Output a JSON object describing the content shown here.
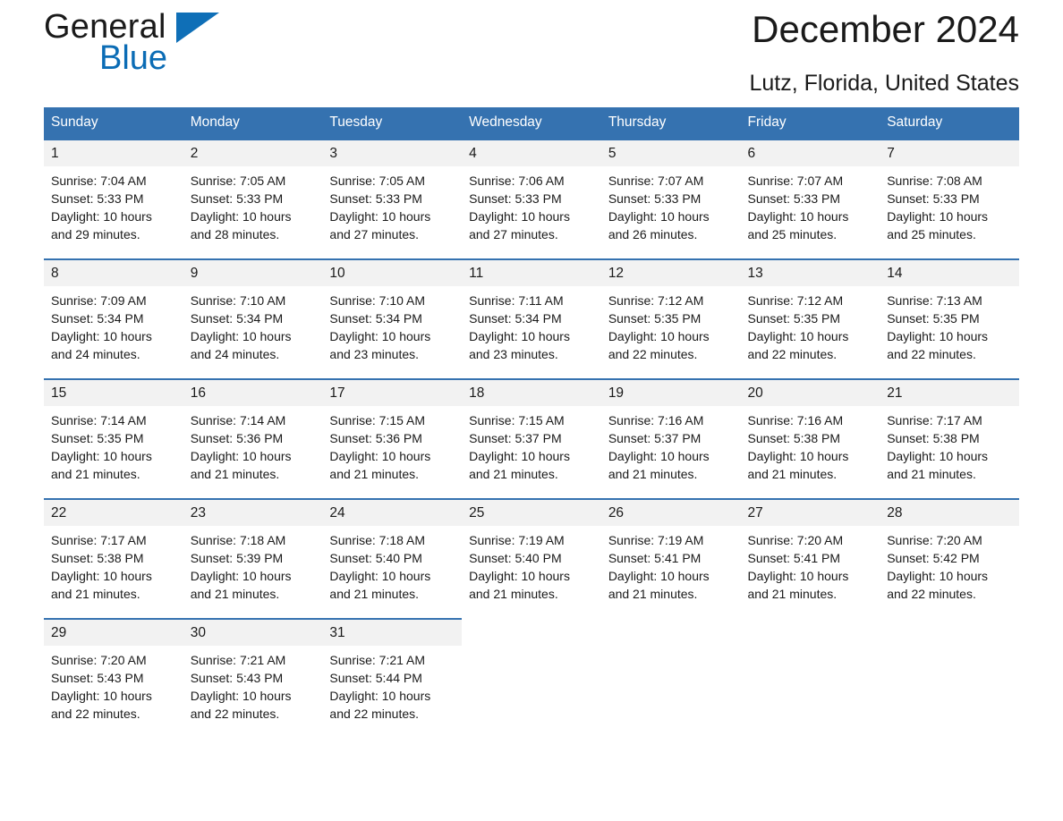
{
  "brand": {
    "name_part1": "General",
    "name_part2": "Blue",
    "flag_icon": "triangle-flag-icon",
    "accent_color": "#0f6fb7"
  },
  "header": {
    "title": "December 2024",
    "subtitle": "Lutz, Florida, United States"
  },
  "calendar": {
    "header_bg": "#3572b0",
    "daynum_bg": "#f2f2f2",
    "weekdays": [
      "Sunday",
      "Monday",
      "Tuesday",
      "Wednesday",
      "Thursday",
      "Friday",
      "Saturday"
    ],
    "weeks": [
      [
        {
          "day": "1",
          "sunrise": "Sunrise: 7:04 AM",
          "sunset": "Sunset: 5:33 PM",
          "daylight_line1": "Daylight: 10 hours",
          "daylight_line2": "and 29 minutes."
        },
        {
          "day": "2",
          "sunrise": "Sunrise: 7:05 AM",
          "sunset": "Sunset: 5:33 PM",
          "daylight_line1": "Daylight: 10 hours",
          "daylight_line2": "and 28 minutes."
        },
        {
          "day": "3",
          "sunrise": "Sunrise: 7:05 AM",
          "sunset": "Sunset: 5:33 PM",
          "daylight_line1": "Daylight: 10 hours",
          "daylight_line2": "and 27 minutes."
        },
        {
          "day": "4",
          "sunrise": "Sunrise: 7:06 AM",
          "sunset": "Sunset: 5:33 PM",
          "daylight_line1": "Daylight: 10 hours",
          "daylight_line2": "and 27 minutes."
        },
        {
          "day": "5",
          "sunrise": "Sunrise: 7:07 AM",
          "sunset": "Sunset: 5:33 PM",
          "daylight_line1": "Daylight: 10 hours",
          "daylight_line2": "and 26 minutes."
        },
        {
          "day": "6",
          "sunrise": "Sunrise: 7:07 AM",
          "sunset": "Sunset: 5:33 PM",
          "daylight_line1": "Daylight: 10 hours",
          "daylight_line2": "and 25 minutes."
        },
        {
          "day": "7",
          "sunrise": "Sunrise: 7:08 AM",
          "sunset": "Sunset: 5:33 PM",
          "daylight_line1": "Daylight: 10 hours",
          "daylight_line2": "and 25 minutes."
        }
      ],
      [
        {
          "day": "8",
          "sunrise": "Sunrise: 7:09 AM",
          "sunset": "Sunset: 5:34 PM",
          "daylight_line1": "Daylight: 10 hours",
          "daylight_line2": "and 24 minutes."
        },
        {
          "day": "9",
          "sunrise": "Sunrise: 7:10 AM",
          "sunset": "Sunset: 5:34 PM",
          "daylight_line1": "Daylight: 10 hours",
          "daylight_line2": "and 24 minutes."
        },
        {
          "day": "10",
          "sunrise": "Sunrise: 7:10 AM",
          "sunset": "Sunset: 5:34 PM",
          "daylight_line1": "Daylight: 10 hours",
          "daylight_line2": "and 23 minutes."
        },
        {
          "day": "11",
          "sunrise": "Sunrise: 7:11 AM",
          "sunset": "Sunset: 5:34 PM",
          "daylight_line1": "Daylight: 10 hours",
          "daylight_line2": "and 23 minutes."
        },
        {
          "day": "12",
          "sunrise": "Sunrise: 7:12 AM",
          "sunset": "Sunset: 5:35 PM",
          "daylight_line1": "Daylight: 10 hours",
          "daylight_line2": "and 22 minutes."
        },
        {
          "day": "13",
          "sunrise": "Sunrise: 7:12 AM",
          "sunset": "Sunset: 5:35 PM",
          "daylight_line1": "Daylight: 10 hours",
          "daylight_line2": "and 22 minutes."
        },
        {
          "day": "14",
          "sunrise": "Sunrise: 7:13 AM",
          "sunset": "Sunset: 5:35 PM",
          "daylight_line1": "Daylight: 10 hours",
          "daylight_line2": "and 22 minutes."
        }
      ],
      [
        {
          "day": "15",
          "sunrise": "Sunrise: 7:14 AM",
          "sunset": "Sunset: 5:35 PM",
          "daylight_line1": "Daylight: 10 hours",
          "daylight_line2": "and 21 minutes."
        },
        {
          "day": "16",
          "sunrise": "Sunrise: 7:14 AM",
          "sunset": "Sunset: 5:36 PM",
          "daylight_line1": "Daylight: 10 hours",
          "daylight_line2": "and 21 minutes."
        },
        {
          "day": "17",
          "sunrise": "Sunrise: 7:15 AM",
          "sunset": "Sunset: 5:36 PM",
          "daylight_line1": "Daylight: 10 hours",
          "daylight_line2": "and 21 minutes."
        },
        {
          "day": "18",
          "sunrise": "Sunrise: 7:15 AM",
          "sunset": "Sunset: 5:37 PM",
          "daylight_line1": "Daylight: 10 hours",
          "daylight_line2": "and 21 minutes."
        },
        {
          "day": "19",
          "sunrise": "Sunrise: 7:16 AM",
          "sunset": "Sunset: 5:37 PM",
          "daylight_line1": "Daylight: 10 hours",
          "daylight_line2": "and 21 minutes."
        },
        {
          "day": "20",
          "sunrise": "Sunrise: 7:16 AM",
          "sunset": "Sunset: 5:38 PM",
          "daylight_line1": "Daylight: 10 hours",
          "daylight_line2": "and 21 minutes."
        },
        {
          "day": "21",
          "sunrise": "Sunrise: 7:17 AM",
          "sunset": "Sunset: 5:38 PM",
          "daylight_line1": "Daylight: 10 hours",
          "daylight_line2": "and 21 minutes."
        }
      ],
      [
        {
          "day": "22",
          "sunrise": "Sunrise: 7:17 AM",
          "sunset": "Sunset: 5:38 PM",
          "daylight_line1": "Daylight: 10 hours",
          "daylight_line2": "and 21 minutes."
        },
        {
          "day": "23",
          "sunrise": "Sunrise: 7:18 AM",
          "sunset": "Sunset: 5:39 PM",
          "daylight_line1": "Daylight: 10 hours",
          "daylight_line2": "and 21 minutes."
        },
        {
          "day": "24",
          "sunrise": "Sunrise: 7:18 AM",
          "sunset": "Sunset: 5:40 PM",
          "daylight_line1": "Daylight: 10 hours",
          "daylight_line2": "and 21 minutes."
        },
        {
          "day": "25",
          "sunrise": "Sunrise: 7:19 AM",
          "sunset": "Sunset: 5:40 PM",
          "daylight_line1": "Daylight: 10 hours",
          "daylight_line2": "and 21 minutes."
        },
        {
          "day": "26",
          "sunrise": "Sunrise: 7:19 AM",
          "sunset": "Sunset: 5:41 PM",
          "daylight_line1": "Daylight: 10 hours",
          "daylight_line2": "and 21 minutes."
        },
        {
          "day": "27",
          "sunrise": "Sunrise: 7:20 AM",
          "sunset": "Sunset: 5:41 PM",
          "daylight_line1": "Daylight: 10 hours",
          "daylight_line2": "and 21 minutes."
        },
        {
          "day": "28",
          "sunrise": "Sunrise: 7:20 AM",
          "sunset": "Sunset: 5:42 PM",
          "daylight_line1": "Daylight: 10 hours",
          "daylight_line2": "and 22 minutes."
        }
      ],
      [
        {
          "day": "29",
          "sunrise": "Sunrise: 7:20 AM",
          "sunset": "Sunset: 5:43 PM",
          "daylight_line1": "Daylight: 10 hours",
          "daylight_line2": "and 22 minutes."
        },
        {
          "day": "30",
          "sunrise": "Sunrise: 7:21 AM",
          "sunset": "Sunset: 5:43 PM",
          "daylight_line1": "Daylight: 10 hours",
          "daylight_line2": "and 22 minutes."
        },
        {
          "day": "31",
          "sunrise": "Sunrise: 7:21 AM",
          "sunset": "Sunset: 5:44 PM",
          "daylight_line1": "Daylight: 10 hours",
          "daylight_line2": "and 22 minutes."
        },
        {
          "day": "",
          "sunrise": "",
          "sunset": "",
          "daylight_line1": "",
          "daylight_line2": ""
        },
        {
          "day": "",
          "sunrise": "",
          "sunset": "",
          "daylight_line1": "",
          "daylight_line2": ""
        },
        {
          "day": "",
          "sunrise": "",
          "sunset": "",
          "daylight_line1": "",
          "daylight_line2": ""
        },
        {
          "day": "",
          "sunrise": "",
          "sunset": "",
          "daylight_line1": "",
          "daylight_line2": ""
        }
      ]
    ]
  }
}
